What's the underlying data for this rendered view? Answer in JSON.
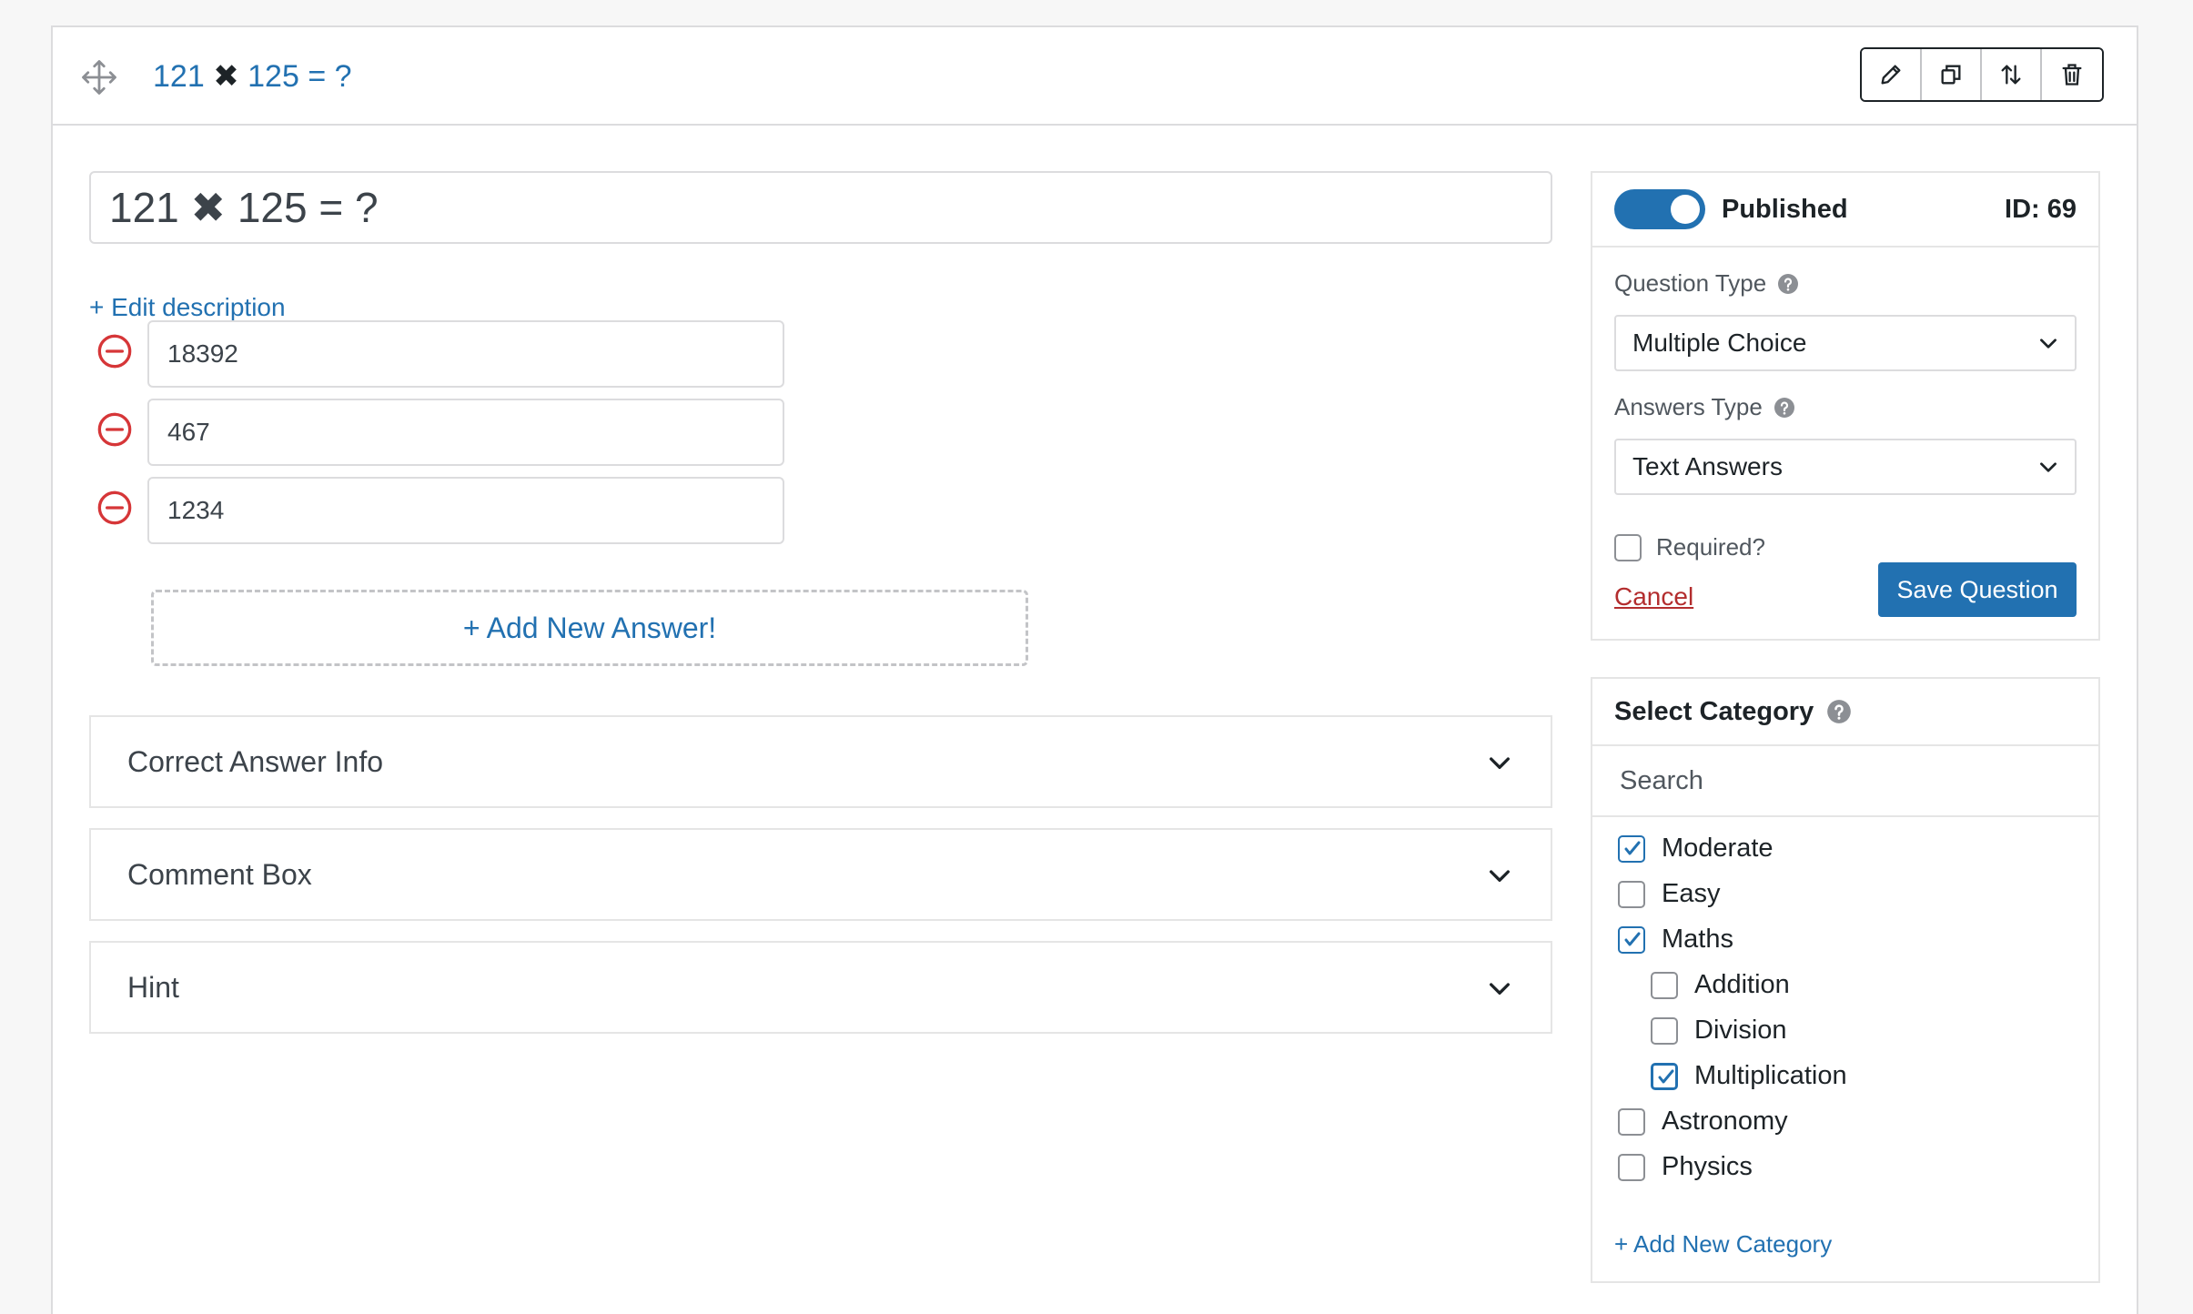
{
  "question": {
    "header_title_a": "121",
    "header_title_times": "✖",
    "header_title_b": "125 = ?",
    "title_value": "121 ✖ 125 = ?",
    "edit_description_label": "+ Edit description",
    "answers": [
      "18392",
      "467",
      "1234"
    ],
    "add_answer_label": "+ Add New Answer!",
    "sections": [
      "Correct Answer Info",
      "Comment Box",
      "Hint"
    ]
  },
  "toolbar": {
    "icons": [
      "pencil-icon",
      "duplicate-icon",
      "reorder-icon",
      "trash-icon"
    ]
  },
  "publish": {
    "status_label": "Published",
    "id_label": "ID: 69",
    "question_type_label": "Question Type",
    "question_type_value": "Multiple Choice",
    "answers_type_label": "Answers Type",
    "answers_type_value": "Text Answers",
    "required_label": "Required?",
    "cancel_label": "Cancel",
    "save_label": "Save Question"
  },
  "category": {
    "title": "Select Category",
    "search_placeholder": "Search",
    "items": [
      {
        "label": "Moderate",
        "checked": true,
        "level": 0
      },
      {
        "label": "Easy",
        "checked": false,
        "level": 0
      },
      {
        "label": "Maths",
        "checked": true,
        "level": 0
      },
      {
        "label": "Addition",
        "checked": false,
        "level": 1
      },
      {
        "label": "Division",
        "checked": false,
        "level": 1
      },
      {
        "label": "Multiplication",
        "checked": true,
        "level": 1
      },
      {
        "label": "Astronomy",
        "checked": false,
        "level": 0
      },
      {
        "label": "Physics",
        "checked": false,
        "level": 0
      }
    ],
    "add_label": "+ Add New Category"
  },
  "colors": {
    "accent": "#2271b1",
    "danger": "#b32d2e",
    "border": "#dcdcde"
  }
}
